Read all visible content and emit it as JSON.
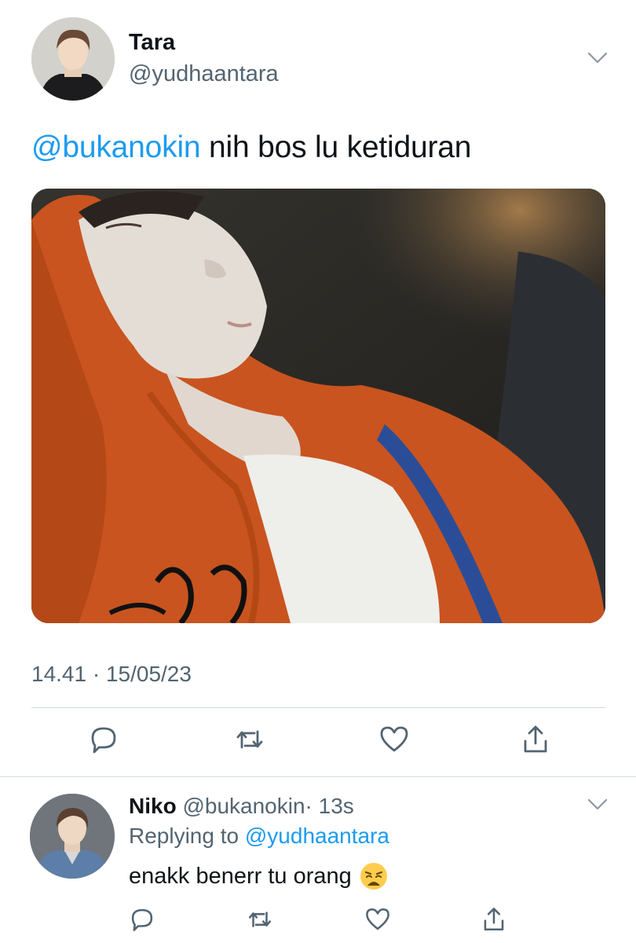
{
  "tweet": {
    "author_name": "Tara",
    "author_handle": "@yudhaantara",
    "mention": "@bukanokin",
    "text": " nih bos lu ketiduran",
    "timestamp": "14.41 · 15/05/23",
    "menu_icon": "chevron-down-icon"
  },
  "reply": {
    "author_name": "Niko",
    "author_handle": "@bukanokin",
    "time": "· 13s",
    "replying_prefix": "Replying to ",
    "replying_handle": "@yudhaantara",
    "text": "enakk benerr tu orang",
    "emoji": "weary-face-emoji"
  },
  "actions": [
    "reply-icon",
    "retweet-icon",
    "like-icon",
    "share-icon"
  ],
  "colors": {
    "accent": "#1d9bf0",
    "secondary_text": "#536471",
    "divider": "#cfd9de",
    "hoodie": "#c9541f"
  }
}
